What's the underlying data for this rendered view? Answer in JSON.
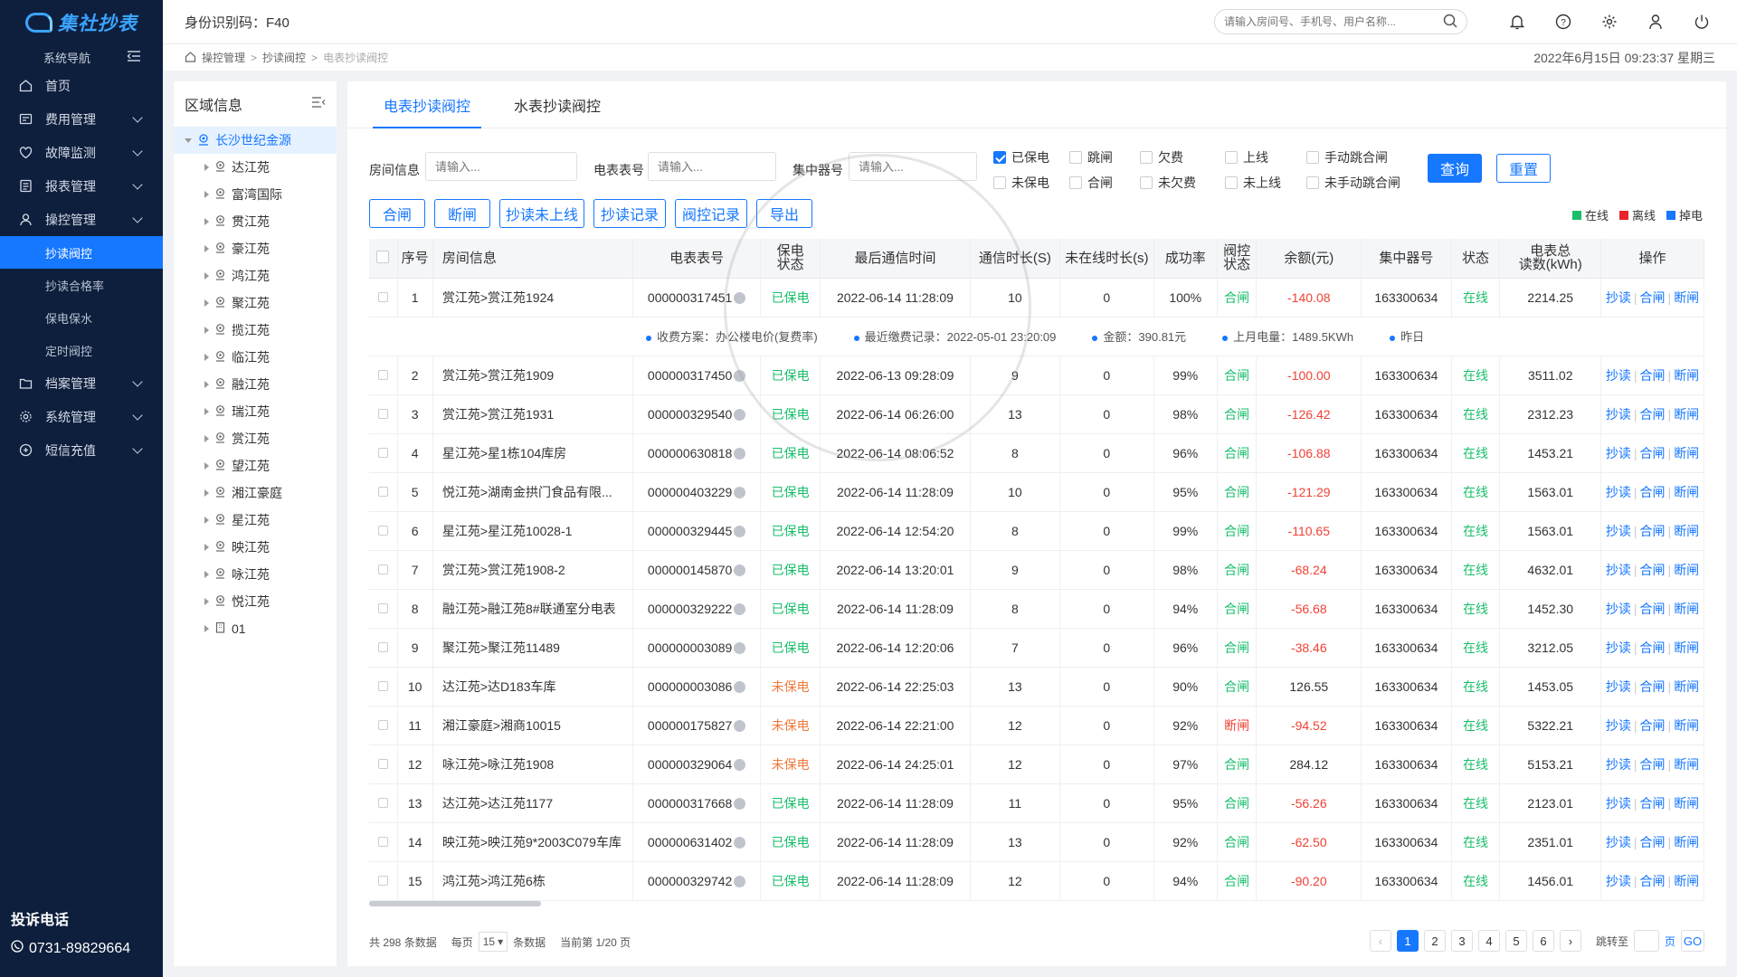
{
  "app": {
    "logo_text": "集社抄表",
    "nav_title": "系统导航"
  },
  "sidebar": {
    "items": [
      {
        "label": "首页",
        "icon": "home-icon"
      },
      {
        "label": "费用管理",
        "icon": "fee-icon"
      },
      {
        "label": "故障监测",
        "icon": "fault-icon"
      },
      {
        "label": "报表管理",
        "icon": "report-icon"
      },
      {
        "label": "操控管理",
        "icon": "control-icon"
      }
    ],
    "sub_items": [
      "抄读阀控",
      "抄读合格率",
      "保电保水",
      "定时阀控"
    ],
    "items_after": [
      {
        "label": "档案管理",
        "icon": "folder-icon"
      },
      {
        "label": "系统管理",
        "icon": "gear-icon"
      },
      {
        "label": "短信充值",
        "icon": "sms-icon"
      }
    ],
    "hotline_title": "投诉电话",
    "hotline_phone": "0731-89829664"
  },
  "header": {
    "idcode": "身份识别码：F40",
    "search_placeholder": "请输入房间号、手机号、用户名称..."
  },
  "breadcrumb": {
    "items": [
      "操控管理",
      "抄读阀控",
      "电表抄读阀控"
    ],
    "datetime": "2022年6月15日 09:23:37 星期三"
  },
  "region": {
    "title": "区域信息",
    "root": "长沙世纪金源",
    "nodes": [
      "达江苑",
      "富湾国际",
      "贯江苑",
      "豪江苑",
      "鸿江苑",
      "聚江苑",
      "揽江苑",
      "临江苑",
      "融江苑",
      "瑞江苑",
      "赏江苑",
      "望江苑",
      "湘江豪庭",
      "星江苑",
      "映江苑",
      "咏江苑",
      "悦江苑",
      "01"
    ]
  },
  "tabs": [
    "电表抄读阀控",
    "水表抄读阀控"
  ],
  "filters": {
    "room_label": "房间信息",
    "room_placeholder": "请输入...",
    "meter_label": "电表表号",
    "meter_placeholder": "请输入...",
    "hub_label": "集中器号",
    "hub_placeholder": "请输入...",
    "checkboxes": [
      {
        "label": "已保电",
        "checked": true
      },
      {
        "label": "跳闸",
        "checked": false
      },
      {
        "label": "欠费",
        "checked": false
      },
      {
        "label": "上线",
        "checked": false
      },
      {
        "label": "手动跳合闸",
        "checked": false
      },
      {
        "label": "未保电",
        "checked": false
      },
      {
        "label": "合闸",
        "checked": false
      },
      {
        "label": "未欠费",
        "checked": false
      },
      {
        "label": "未上线",
        "checked": false
      },
      {
        "label": "未手动跳合闸",
        "checked": false
      }
    ],
    "query": "查询",
    "reset": "重置"
  },
  "actions": [
    "合闸",
    "断闸",
    "抄读未上线",
    "抄读记录",
    "阀控记录",
    "导出"
  ],
  "legend": [
    {
      "label": "在线",
      "color": "#19be6b"
    },
    {
      "label": "离线",
      "color": "#e8242a"
    },
    {
      "label": "掉电",
      "color": "#1677ff"
    }
  ],
  "table": {
    "headers": [
      "序号",
      "房间信息",
      "电表表号",
      "保电\n状态",
      "最后通信时间",
      "通信时长(S)",
      "未在线时长(s)",
      "成功率",
      "阀控\n状态",
      "余额(元)",
      "集中器号",
      "状态",
      "电表总\n读数(kWh)",
      "操作"
    ],
    "ops": [
      "抄读",
      "合闸",
      "断闸"
    ],
    "detail": [
      "收费方案：办公楼电价(复费率)",
      "最近缴费记录：2022-05-01 23:20:09",
      "金额：390.81元",
      "上月电量：1489.5KWh",
      "昨日"
    ],
    "rows": [
      {
        "no": "1",
        "room": "赏江苑>赏江苑1924",
        "meter": "000000317451",
        "guard": "已保电",
        "last": "2022-06-14 11:28:09",
        "dur": "10",
        "off": "0",
        "rate": "100%",
        "valve": "合闸",
        "bal": "-140.08",
        "hub": "163300634",
        "st": "在线",
        "kwh": "2214.25"
      },
      {
        "no": "2",
        "room": "赏江苑>赏江苑1909",
        "meter": "000000317450",
        "guard": "已保电",
        "last": "2022-06-13 09:28:09",
        "dur": "9",
        "off": "0",
        "rate": "99%",
        "valve": "合闸",
        "bal": "-100.00",
        "hub": "163300634",
        "st": "在线",
        "kwh": "3511.02"
      },
      {
        "no": "3",
        "room": "赏江苑>赏江苑1931",
        "meter": "000000329540",
        "guard": "已保电",
        "last": "2022-06-14 06:26:00",
        "dur": "13",
        "off": "0",
        "rate": "98%",
        "valve": "合闸",
        "bal": "-126.42",
        "hub": "163300634",
        "st": "在线",
        "kwh": "2312.23"
      },
      {
        "no": "4",
        "room": "星江苑>星1栋104库房",
        "meter": "000000630818",
        "guard": "已保电",
        "last": "2022-06-14 08:06:52",
        "dur": "8",
        "off": "0",
        "rate": "96%",
        "valve": "合闸",
        "bal": "-106.88",
        "hub": "163300634",
        "st": "在线",
        "kwh": "1453.21"
      },
      {
        "no": "5",
        "room": "悦江苑>湖南金拱门食品有限...",
        "meter": "000000403229",
        "guard": "已保电",
        "last": "2022-06-14 11:28:09",
        "dur": "10",
        "off": "0",
        "rate": "95%",
        "valve": "合闸",
        "bal": "-121.29",
        "hub": "163300634",
        "st": "在线",
        "kwh": "1563.01"
      },
      {
        "no": "6",
        "room": "星江苑>星江苑10028-1",
        "meter": "000000329445",
        "guard": "已保电",
        "last": "2022-06-14 12:54:20",
        "dur": "8",
        "off": "0",
        "rate": "99%",
        "valve": "合闸",
        "bal": "-110.65",
        "hub": "163300634",
        "st": "在线",
        "kwh": "1563.01"
      },
      {
        "no": "7",
        "room": "赏江苑>赏江苑1908-2",
        "meter": "000000145870",
        "guard": "已保电",
        "last": "2022-06-14 13:20:01",
        "dur": "9",
        "off": "0",
        "rate": "98%",
        "valve": "合闸",
        "bal": "-68.24",
        "hub": "163300634",
        "st": "在线",
        "kwh": "4632.01"
      },
      {
        "no": "8",
        "room": "融江苑>融江苑8#联通室分电表",
        "meter": "000000329222",
        "guard": "已保电",
        "last": "2022-06-14 11:28:09",
        "dur": "8",
        "off": "0",
        "rate": "94%",
        "valve": "合闸",
        "bal": "-56.68",
        "hub": "163300634",
        "st": "在线",
        "kwh": "1452.30"
      },
      {
        "no": "9",
        "room": "聚江苑>聚江苑11489",
        "meter": "000000003089",
        "guard": "已保电",
        "last": "2022-06-14 12:20:06",
        "dur": "7",
        "off": "0",
        "rate": "96%",
        "valve": "合闸",
        "bal": "-38.46",
        "hub": "163300634",
        "st": "在线",
        "kwh": "3212.05"
      },
      {
        "no": "10",
        "room": "达江苑>达D183车库",
        "meter": "000000003086",
        "guard": "未保电",
        "last": "2022-06-14 22:25:03",
        "dur": "13",
        "off": "0",
        "rate": "90%",
        "valve": "合闸",
        "bal": "126.55",
        "hub": "163300634",
        "st": "在线",
        "kwh": "1453.05"
      },
      {
        "no": "11",
        "room": "湘江豪庭>湘商10015",
        "meter": "000000175827",
        "guard": "未保电",
        "last": "2022-06-14 22:21:00",
        "dur": "12",
        "off": "0",
        "rate": "92%",
        "valve": "断闸",
        "bal": "-94.52",
        "hub": "163300634",
        "st": "在线",
        "kwh": "5322.21"
      },
      {
        "no": "12",
        "room": "咏江苑>咏江苑1908",
        "meter": "000000329064",
        "guard": "未保电",
        "last": "2022-06-14 24:25:01",
        "dur": "12",
        "off": "0",
        "rate": "97%",
        "valve": "合闸",
        "bal": "284.12",
        "hub": "163300634",
        "st": "在线",
        "kwh": "5153.21"
      },
      {
        "no": "13",
        "room": "达江苑>达江苑1177",
        "meter": "000000317668",
        "guard": "已保电",
        "last": "2022-06-14 11:28:09",
        "dur": "11",
        "off": "0",
        "rate": "95%",
        "valve": "合闸",
        "bal": "-56.26",
        "hub": "163300634",
        "st": "在线",
        "kwh": "2123.01"
      },
      {
        "no": "14",
        "room": "映江苑>映江苑9*2003C079车库",
        "meter": "000000631402",
        "guard": "已保电",
        "last": "2022-06-14 11:28:09",
        "dur": "13",
        "off": "0",
        "rate": "92%",
        "valve": "合闸",
        "bal": "-62.50",
        "hub": "163300634",
        "st": "在线",
        "kwh": "2351.01"
      },
      {
        "no": "15",
        "room": "鸿江苑>鸿江苑6栋",
        "meter": "000000329742",
        "guard": "已保电",
        "last": "2022-06-14 11:28:09",
        "dur": "12",
        "off": "0",
        "rate": "94%",
        "valve": "合闸",
        "bal": "-90.20",
        "hub": "163300634",
        "st": "在线",
        "kwh": "1456.01"
      }
    ]
  },
  "pager": {
    "total": "共 298 条数据",
    "per_page_label": "每页",
    "per_page": "15",
    "unit": "条数据",
    "current": "当前第 1/20 页",
    "pages": [
      "1",
      "2",
      "3",
      "4",
      "5",
      "6"
    ],
    "jump_label": "跳转至",
    "page_unit": "页",
    "go": "GO"
  },
  "colors": {
    "primary": "#1677ff",
    "sidebar_bg": "#0e1f3d",
    "green": "#19be6b",
    "red": "#f04134",
    "orange": "#f07a3c"
  }
}
